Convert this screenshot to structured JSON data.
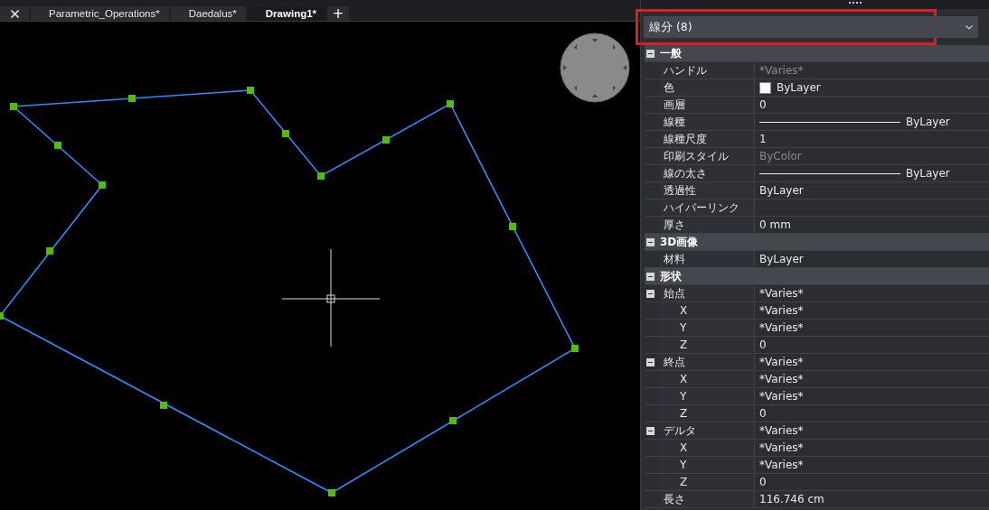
{
  "tabs": [
    {
      "label": "Parametric_Operations*",
      "selected": false
    },
    {
      "label": "Daedalus*",
      "selected": false
    },
    {
      "label": "Drawing1*",
      "selected": true
    }
  ],
  "new_tab": "+",
  "selector": {
    "value": "線分 (8)",
    "highlighted": true
  },
  "properties": [
    {
      "label": "一般",
      "expanded": true,
      "children": [
        {
          "label": "ハンドル",
          "value": "*Varies*",
          "kind": "muted"
        },
        {
          "label": "色",
          "value": "ByLayer",
          "kind": "color",
          "color": "#ffffff"
        },
        {
          "label": "画層",
          "value": "0",
          "kind": "text"
        },
        {
          "label": "線種",
          "value": "ByLayer",
          "kind": "line"
        },
        {
          "label": "線種尺度",
          "value": "1",
          "kind": "text"
        },
        {
          "label": "印刷スタイル",
          "value": "ByColor",
          "kind": "muted"
        },
        {
          "label": "線の太さ",
          "value": "ByLayer",
          "kind": "line"
        },
        {
          "label": "透過性",
          "value": "ByLayer",
          "kind": "text"
        },
        {
          "label": "ハイパーリンク",
          "kind": "text"
        },
        {
          "label": "厚さ",
          "value": "0 mm",
          "kind": "text"
        }
      ]
    },
    {
      "label": "3D画像",
      "expanded": true,
      "children": [
        {
          "label": "材料",
          "value": "ByLayer",
          "kind": "text"
        }
      ]
    },
    {
      "label": "形状",
      "expanded": true,
      "children": [
        {
          "label": "始点",
          "value": "*Varies*",
          "kind": "text",
          "expanded": true,
          "children": [
            {
              "label": "X",
              "value": "*Varies*",
              "kind": "text"
            },
            {
              "label": "Y",
              "value": "*Varies*",
              "kind": "text"
            },
            {
              "label": "Z",
              "value": "0",
              "kind": "text"
            }
          ]
        },
        {
          "label": "終点",
          "value": "*Varies*",
          "kind": "text",
          "expanded": true,
          "children": [
            {
              "label": "X",
              "value": "*Varies*",
              "kind": "text"
            },
            {
              "label": "Y",
              "value": "*Varies*",
              "kind": "text"
            },
            {
              "label": "Z",
              "value": "0",
              "kind": "text"
            }
          ]
        },
        {
          "label": "デルタ",
          "value": "*Varies*",
          "kind": "text",
          "expanded": true,
          "children": [
            {
              "label": "X",
              "value": "*Varies*",
              "kind": "text"
            },
            {
              "label": "Y",
              "value": "*Varies*",
              "kind": "text"
            },
            {
              "label": "Z",
              "value": "0",
              "kind": "text"
            }
          ]
        },
        {
          "label": "長さ",
          "value": "116.746 cm",
          "kind": "text"
        }
      ]
    }
  ]
}
